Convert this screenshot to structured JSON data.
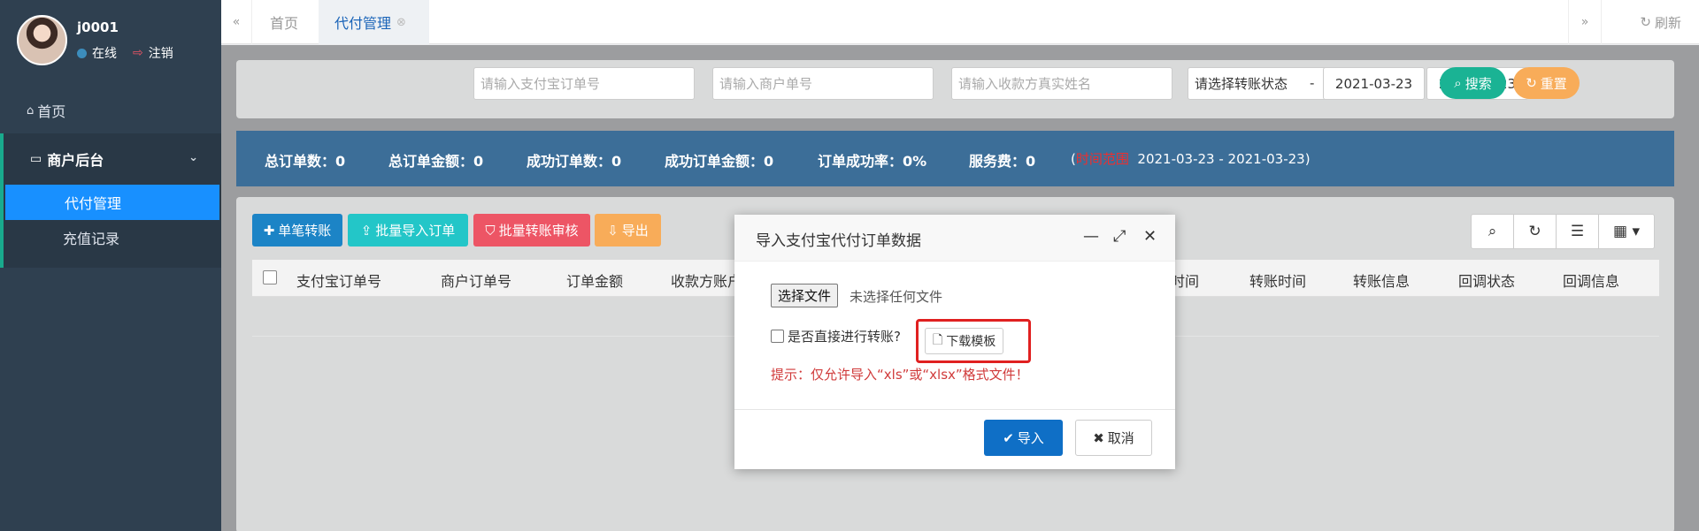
{
  "colors": {
    "sidebar_bg": "#2f4050",
    "active_nav": "#1890ff",
    "stats_bar": "#3c6e98",
    "primary": "#0f6fc6",
    "danger": "#e02020"
  },
  "user": {
    "name": "j0001",
    "status": "在线",
    "logout": "注销"
  },
  "nav": {
    "home": "首页",
    "group": "商户后台",
    "items": [
      {
        "label": "代付管理"
      },
      {
        "label": "充值记录"
      }
    ]
  },
  "tabs": {
    "home": "首页",
    "active": "代付管理",
    "refresh": "刷新"
  },
  "filters": {
    "alipay_order_placeholder": "请输入支付宝订单号",
    "merchant_order_placeholder": "请输入商户单号",
    "payee_name_placeholder": "请输入收款方真实姓名",
    "status_select": "请选择转账状态",
    "date_start": "2021-03-23",
    "date_sep": "-",
    "date_end": "2021-03-23",
    "search": "搜索",
    "reset": "重置"
  },
  "stats": {
    "total_orders": "总订单数：0",
    "total_amount": "总订单金额：0",
    "success_orders": "成功订单数：0",
    "success_amount": "成功订单金额：0",
    "success_rate": "订单成功率：0%",
    "service_fee": "服务费：0",
    "range_open": "(",
    "range_label": "时间范围",
    "range_value": "2021-03-23 - 2021-03-23)"
  },
  "toolbar": {
    "single_transfer": "单笔转账",
    "batch_import": "批量导入订单",
    "batch_review": "批量转账审核",
    "export": "导出"
  },
  "table": {
    "columns": [
      "支付宝订单号",
      "商户订单号",
      "订单金额",
      "收款方账户",
      "时间",
      "转账时间",
      "转账信息",
      "回调状态",
      "回调信息"
    ]
  },
  "modal": {
    "title": "导入支付宝代付订单数据",
    "choose_file": "选择文件",
    "no_file": "未选择任何文件",
    "direct_transfer": "是否直接进行转账?",
    "download_template": "下载模板",
    "hint": "提示：仅允许导入“xls”或“xlsx”格式文件！",
    "import": "导入",
    "cancel": "取消"
  }
}
